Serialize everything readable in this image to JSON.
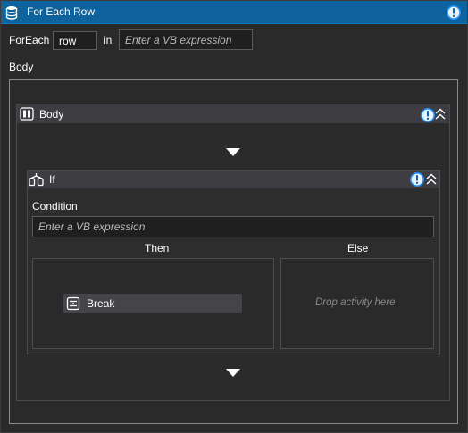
{
  "window": {
    "title": "For Each Row"
  },
  "foreach": {
    "label": "ForEach",
    "item_value": "row",
    "in_label": "in",
    "collection_placeholder": "Enter a VB expression"
  },
  "body_label": "Body",
  "sequence": {
    "title": "Body"
  },
  "if_activity": {
    "title": "If",
    "condition_label": "Condition",
    "condition_placeholder": "Enter a VB expression",
    "then_label": "Then",
    "else_label": "Else",
    "else_drop_hint": "Drop activity here",
    "then_activity": {
      "title": "Break"
    }
  },
  "colors": {
    "title_bar": "#0e639c",
    "background": "#2a2a2a",
    "header": "#3e3e42",
    "info_icon": "#1e90ff"
  },
  "icons": [
    "data-table-icon",
    "info-icon",
    "sequence-icon",
    "collapse-icon",
    "if-icon",
    "break-icon",
    "insert-arrow-icon"
  ]
}
